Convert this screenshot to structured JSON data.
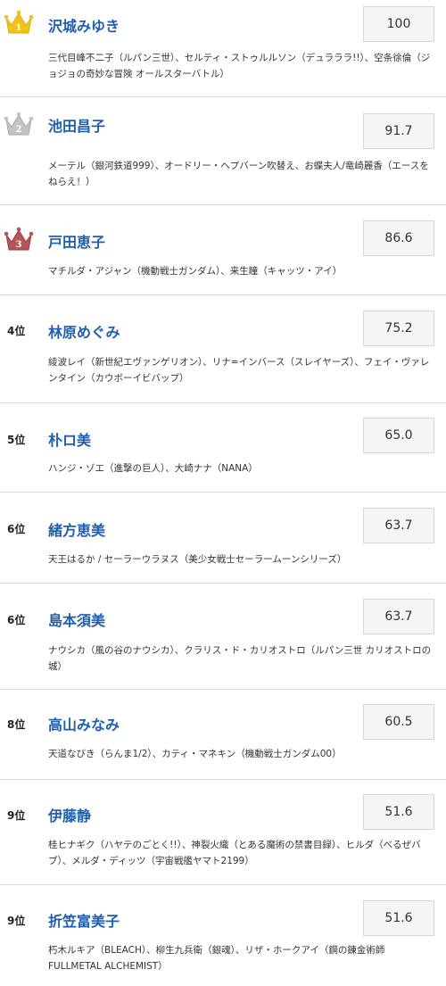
{
  "ranking": [
    {
      "rank_label": "",
      "crown": "gold-crown-1",
      "name": "沢城みゆき",
      "score": "100",
      "roles": "三代目峰不二子（ルパン三世）、セルティ・ストゥルルソン（デュラララ!!）、空条徐倫（ジョジョの奇妙な冒険 オールスターバトル）"
    },
    {
      "rank_label": "",
      "crown": "silver-crown-2",
      "name": "池田昌子",
      "score": "91.7",
      "roles": "メーテル（銀河鉄道999）、オードリー・ヘプバーン吹替え、お蝶夫人/竜崎麗香（エースをねらえ！）"
    },
    {
      "rank_label": "",
      "crown": "bronze-crown-3",
      "name": "戸田恵子",
      "score": "86.6",
      "roles": "マチルダ・アジャン（機動戦士ガンダム）、来生瞳（キャッツ・アイ）"
    },
    {
      "rank_label": "4位",
      "crown": "",
      "name": "林原めぐみ",
      "score": "75.2",
      "roles": "綾波レイ（新世紀エヴァンゲリオン）、リナ=インバース（スレイヤーズ）、フェイ・ヴァレンタイン（カウボーイビバップ）"
    },
    {
      "rank_label": "5位",
      "crown": "",
      "name": "朴ロ美",
      "score": "65.0",
      "roles": "ハンジ・ゾエ（進撃の巨人）、大崎ナナ（NANA）"
    },
    {
      "rank_label": "6位",
      "crown": "",
      "name": "緒方恵美",
      "score": "63.7",
      "roles": "天王はるか / セーラーウラヌス（美少女戦士セーラームーンシリーズ）"
    },
    {
      "rank_label": "6位",
      "crown": "",
      "name": "島本須美",
      "score": "63.7",
      "roles": "ナウシカ（風の谷のナウシカ）、クラリス・ド・カリオストロ（ルパン三世 カリオストロの城）"
    },
    {
      "rank_label": "8位",
      "crown": "",
      "name": "高山みなみ",
      "score": "60.5",
      "roles": "天道なびき（らんま1/2）、カティ・マネキン（機動戦士ガンダム00）"
    },
    {
      "rank_label": "9位",
      "crown": "",
      "name": "伊藤静",
      "score": "51.6",
      "roles": "桂ヒナギク（ハヤテのごとく!!）、神裂火織（とある魔術の禁書目録）、ヒルダ（べるぜバブ）、メルダ・ディッツ（宇宙戦艦ヤマト2199）"
    },
    {
      "rank_label": "9位",
      "crown": "",
      "name": "折笠富美子",
      "score": "51.6",
      "roles": "朽木ルキア（BLEACH）、柳生九兵衛（銀魂）、リザ・ホークアイ（鋼の錬金術師 FULLMETAL ALCHEMIST）"
    }
  ],
  "colors": {
    "name_link": "#1f5fb0",
    "gold": "#f2c21b",
    "silver": "#c4c4c4",
    "bronze": "#b5565a",
    "score_bg": "#f5f5f5",
    "divider": "#dcdcdc"
  }
}
